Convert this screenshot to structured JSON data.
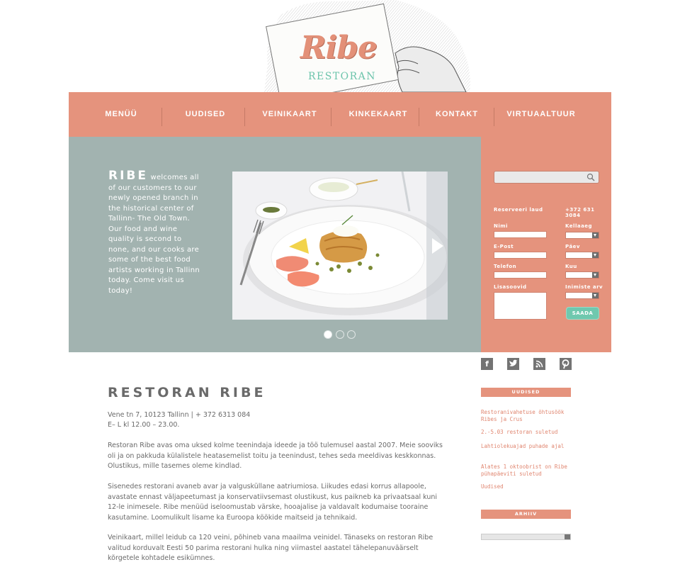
{
  "header": {
    "logo_name": "Ribe",
    "logo_sub": "RESTORAN"
  },
  "nav": {
    "items": [
      "MENÜÜ",
      "UUDISED",
      "VEINIKAART",
      "KINKEKAART",
      "KONTAKT",
      "VIRTUAALTUUR"
    ]
  },
  "hero": {
    "brand": "RIBE",
    "text": " welcomes all of our customers to our newly opened branch in the historical center of Tallinn- The Old Town. Our food and wine quality is second to none, and our cooks are some of the best food artists working in Tallinn today. Come visit us today!",
    "slides_count": 3,
    "active_slide": 1
  },
  "reservation": {
    "title": "Reserveeri laud",
    "phone": "+372 631 3084",
    "labels": {
      "name": "Nimi",
      "email": "E-Post",
      "phone": "Telefon",
      "extra": "Lisasoovid",
      "time": "Kellaaeg",
      "day": "Päev",
      "month": "Kuu",
      "people": "Inimiste arv"
    },
    "submit": "SAADA"
  },
  "social": [
    "f",
    "t",
    "rss",
    "p"
  ],
  "main": {
    "title": "RESTORAN RIBE",
    "address": "Vene tn 7, 10123 Tallinn | + 372 6313 084",
    "hours": "E– L kl 12.00 – 23.00.",
    "p1": "Restoran Ribe avas oma uksed kolme teenindaja ideede ja töö tulemusel aastal 2007. Meie sooviks oli ja on pakkuda külalistele heatasemelist toitu ja teenindust, tehes seda meeldivas keskkonnas. Olustikus, mille tasemes oleme kindlad.",
    "p2": "Sisenedes restorani avaneb avar ja valgusküllane aatriumiosa. Liikudes edasi korrus allapoole, avastate ennast väljapeetumast ja konservatiivsemast olustikust, kus paikneb ka privaatsaal kuni 12-le inimesele. Ribe menüüd iseloomustab värske, hooajalise ja valdavalt kodumaise tooraine kasutamine. Loomulikult lisame ka Euroopa köökide maitseid ja tehnikaid.",
    "p3": "Veinikaart, millel leidub ca 120 veini, põhineb vana maailma veinidel. Tänaseks on restoran Ribe valitud korduvalt Eesti 50 parima restorani hulka ning viimastel aastatel tähelepanuväärselt kõrgetele kohtadele esikümnes."
  },
  "sidebar": {
    "news_title": "UUDISED",
    "news": [
      "Restoranivahetuse õhtusöök Ribes ja Crus",
      "2.-5.03 restoran suletud",
      "Lahtiolekuajad puhade ajal",
      "Alates 1 oktoobrist on Ribe pühapäeviti suletud",
      "Uudised"
    ],
    "archive_title": "ARHIIV"
  },
  "colors": {
    "accent": "#e5937d",
    "hero_bg": "#a2b3b0",
    "logo_teal": "#6cc4ab",
    "submit": "#6fc8ae"
  }
}
